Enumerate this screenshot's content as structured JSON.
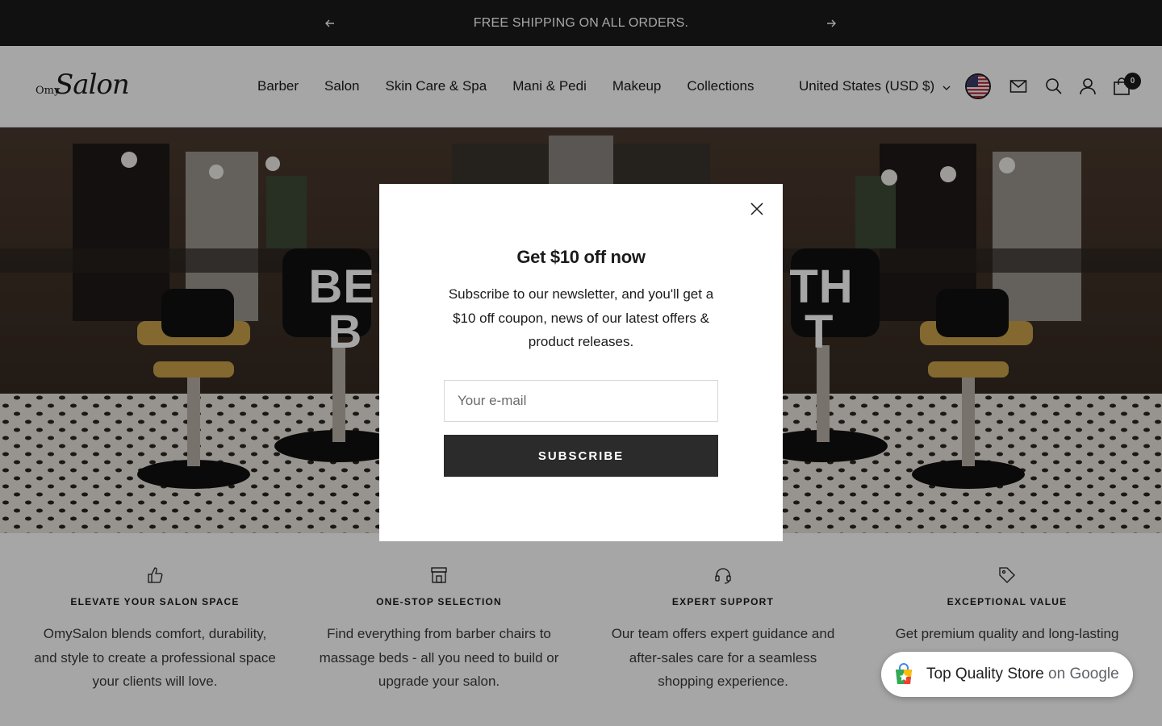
{
  "announcement": {
    "text": "FREE SHIPPING ON ALL ORDERS.",
    "prev_icon": "arrow-left-icon",
    "next_icon": "arrow-right-icon"
  },
  "header": {
    "logo_small": "Omy",
    "logo_large": "Salon",
    "nav": [
      "Barber",
      "Salon",
      "Skin Care & Spa",
      "Mani & Pedi",
      "Makeup",
      "Collections"
    ],
    "currency": "United States (USD $)",
    "cart_count": "0",
    "icons": [
      "us-flag-icon",
      "mail-icon",
      "search-icon",
      "account-icon",
      "cart-icon"
    ]
  },
  "hero": {
    "title_line1": "BE                              TH",
    "title_line2": "B                                T"
  },
  "modal": {
    "title": "Get $10 off now",
    "text": "Subscribe to our newsletter, and you'll get a $10 off coupon, news of our latest offers & product releases.",
    "email_placeholder": "Your e-mail",
    "button": "SUBSCRIBE"
  },
  "features": [
    {
      "icon": "thumbs-up-icon",
      "title": "ELEVATE YOUR SALON SPACE",
      "desc": "OmySalon blends comfort, durability, and style to create a professional space your clients will love."
    },
    {
      "icon": "store-icon",
      "title": "ONE-STOP SELECTION",
      "desc": "Find everything from barber chairs to massage beds - all you need to build or upgrade your salon."
    },
    {
      "icon": "headset-icon",
      "title": "EXPERT SUPPORT",
      "desc": "Our team offers expert guidance and after-sales care for a seamless shopping experience."
    },
    {
      "icon": "tag-icon",
      "title": "EXCEPTIONAL VALUE",
      "desc": "Get premium quality and long-lasting"
    }
  ],
  "google_badge": {
    "label": "Top Quality Store",
    "suffix": "on Google"
  },
  "colors": {
    "dark": "#1c1b1b",
    "button": "#2b2b2b"
  }
}
